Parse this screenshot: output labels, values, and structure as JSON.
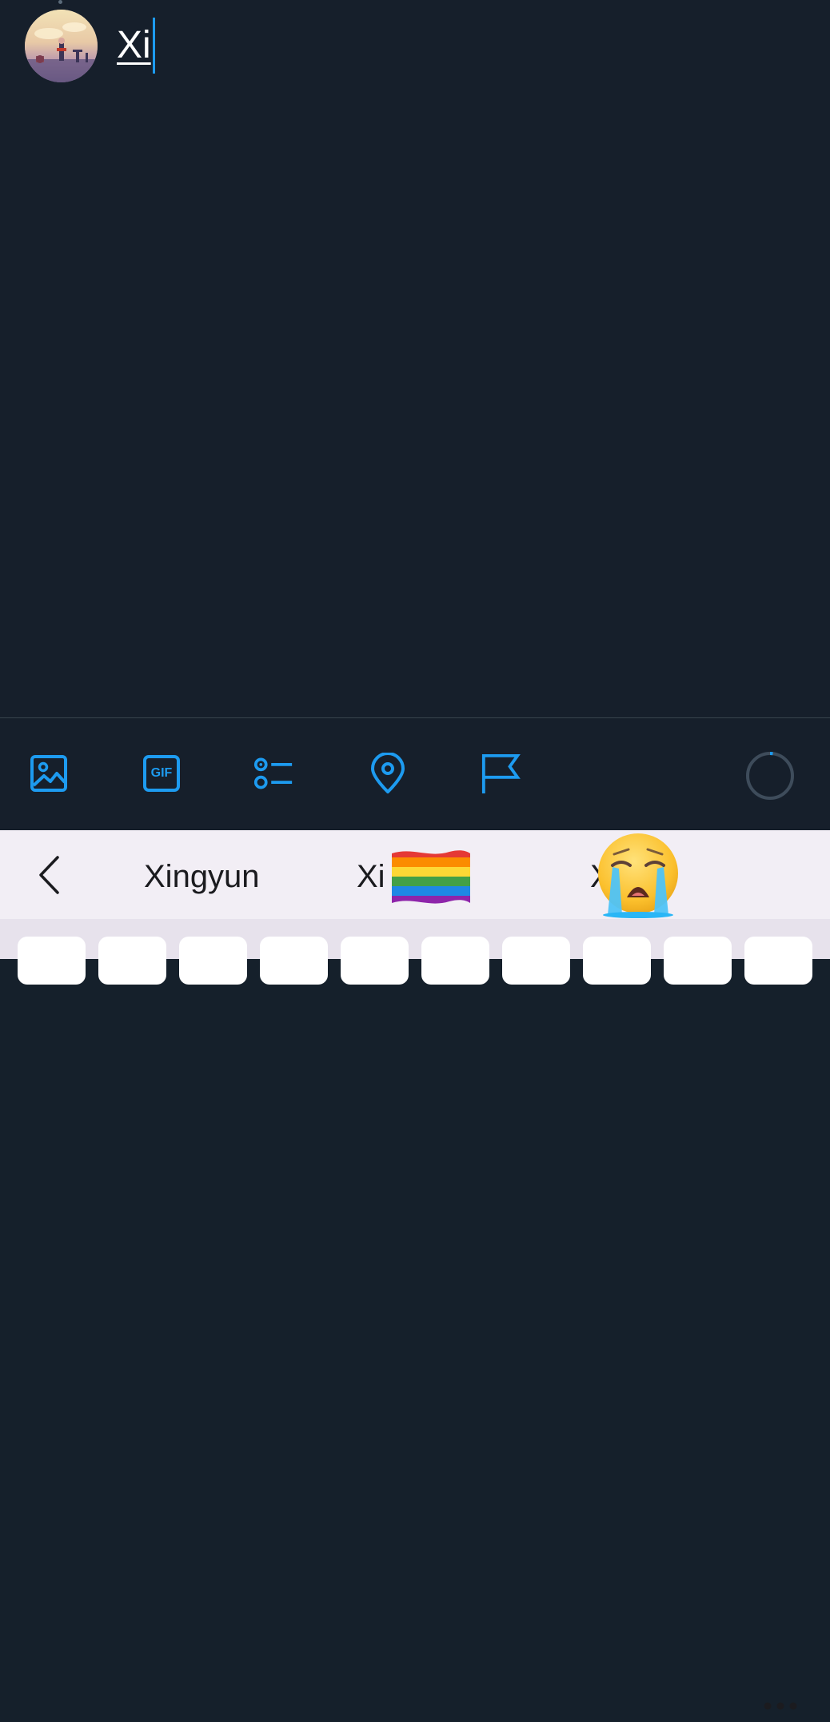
{
  "composer": {
    "typed_text": "Xi",
    "avatar_alt": "user avatar"
  },
  "toolbar": {
    "buttons": [
      {
        "name": "media",
        "icon": "image-icon"
      },
      {
        "name": "gif",
        "icon": "gif-icon",
        "label": "GIF"
      },
      {
        "name": "poll",
        "icon": "poll-icon"
      },
      {
        "name": "location",
        "icon": "location-pin-icon"
      },
      {
        "name": "flag",
        "icon": "flag-icon"
      }
    ],
    "character_progress": 0.02,
    "accent_color": "#1d9bf0"
  },
  "keyboard": {
    "suggestions": [
      {
        "type": "word",
        "text": "Xingyun"
      },
      {
        "type": "word",
        "text": "Xi"
      },
      {
        "type": "emoji",
        "text": "🏳️‍🌈",
        "icon": "rainbow-flag-icon"
      },
      {
        "type": "word",
        "text": "X"
      },
      {
        "type": "emoji",
        "text": "😭",
        "icon": "loudly-crying-face-icon"
      }
    ],
    "back_icon": "chevron-left-icon",
    "more_icon": "more-dots-icon",
    "visible_key_count": 10
  }
}
